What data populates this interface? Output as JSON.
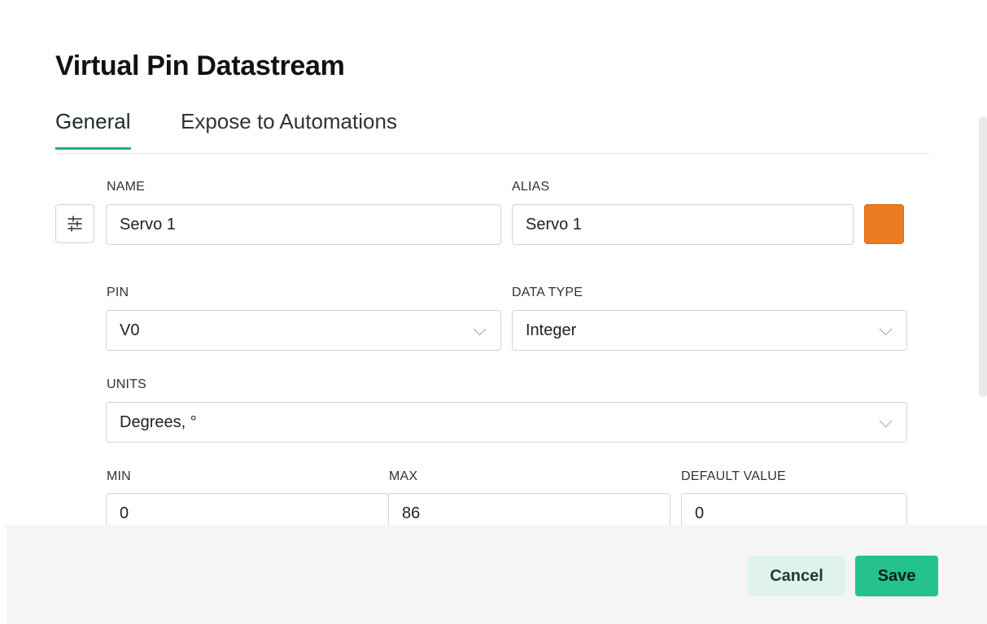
{
  "dialog": {
    "title": "Virtual Pin Datastream",
    "tabs": [
      {
        "label": "General",
        "active": true
      },
      {
        "label": "Expose to Automations",
        "active": false
      }
    ]
  },
  "form": {
    "name": {
      "label": "NAME",
      "value": "Servo 1"
    },
    "alias": {
      "label": "ALIAS",
      "value": "Servo 1"
    },
    "color": {
      "value": "#EC7A22"
    },
    "pin": {
      "label": "PIN",
      "value": "V0"
    },
    "data_type": {
      "label": "DATA TYPE",
      "value": "Integer"
    },
    "units": {
      "label": "UNITS",
      "value": "Degrees, °"
    },
    "min": {
      "label": "MIN",
      "value": "0"
    },
    "max": {
      "label": "MAX",
      "value": "86"
    },
    "default_value": {
      "label": "DEFAULT VALUE",
      "value": "0"
    },
    "settings_icon": "sliders-icon"
  },
  "footer": {
    "cancel_label": "Cancel",
    "save_label": "Save"
  },
  "colors": {
    "accent": "#23B07C",
    "save_button": "#23C28C",
    "cancel_button": "#DFF3EA"
  }
}
